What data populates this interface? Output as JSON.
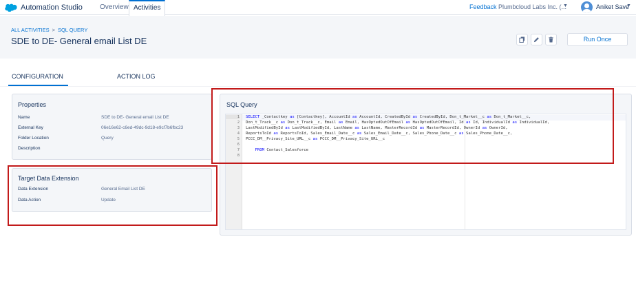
{
  "topnav": {
    "app_title": "Automation Studio",
    "tabs": [
      {
        "label": "Overview",
        "active": false
      },
      {
        "label": "Activities",
        "active": true
      }
    ],
    "feedback": "Feedback",
    "org": "Plumbcloud Labs Inc. (...",
    "user": "Aniket Save",
    "logo_icon": "salesforce-cloud-icon",
    "accent_color": "#0070d2"
  },
  "header": {
    "breadcrumb": [
      "ALL ACTIVITIES",
      "SQL QUERY"
    ],
    "breadcrumb_sep": ">",
    "title": "SDE to DE- General email List DE",
    "actions": [
      "copy-icon",
      "pencil-icon",
      "trash-icon"
    ],
    "run_label": "Run Once"
  },
  "subtabs": {
    "configuration": "CONFIGURATION",
    "action_log": "ACTION LOG"
  },
  "properties": {
    "title": "Properties",
    "rows": [
      {
        "label": "Name",
        "value": "SDE to DE- General email List DE"
      },
      {
        "label": "External Key",
        "value": "06e16e62-c6ed-49dc-9d18-e9cf7b6fbc23"
      },
      {
        "label": "Folder Location",
        "value": "Query"
      },
      {
        "label": "Description",
        "value": ""
      }
    ]
  },
  "target": {
    "title": "Target Data Extension",
    "rows": [
      {
        "label": "Data Extension",
        "value": "General Email List DE"
      },
      {
        "label": "Data Action",
        "value": "Update"
      }
    ]
  },
  "sql": {
    "title": "SQL Query",
    "line_numbers": [
      "1",
      "2",
      "3",
      "4",
      "5",
      "6",
      "7",
      "8"
    ],
    "lines": [
      "SELECT _Contactkey as [Contactkey], AccountId as AccountId, CreatedById as CreatedById, Don_t_Market__c as Don_t_Market__c,",
      "Don_t_Track__c as Don_t_Track__c, Email as Email, HasOptedOutOfEmail as HasOptedOutOfEmail, Id as Id, IndividualId as IndividualId,",
      "LastModifiedById as LastModifiedById, LastName as LastName, MasterRecordId as MasterRecordId, OwnerId as OwnerId,",
      "ReportsToId as ReportsToId, Sales_Email_Date__c as Sales_Email_Date__c, Sales_Phone_Date__c as Sales_Phone_Date__c,",
      "PCCC_DM__Privacy_Site_URL__c as PCCC_DM__Privacy_Site_URL__c",
      "",
      "    FROM Contact_Salesforce",
      ""
    ]
  },
  "highlight_color": "#c21a1a"
}
